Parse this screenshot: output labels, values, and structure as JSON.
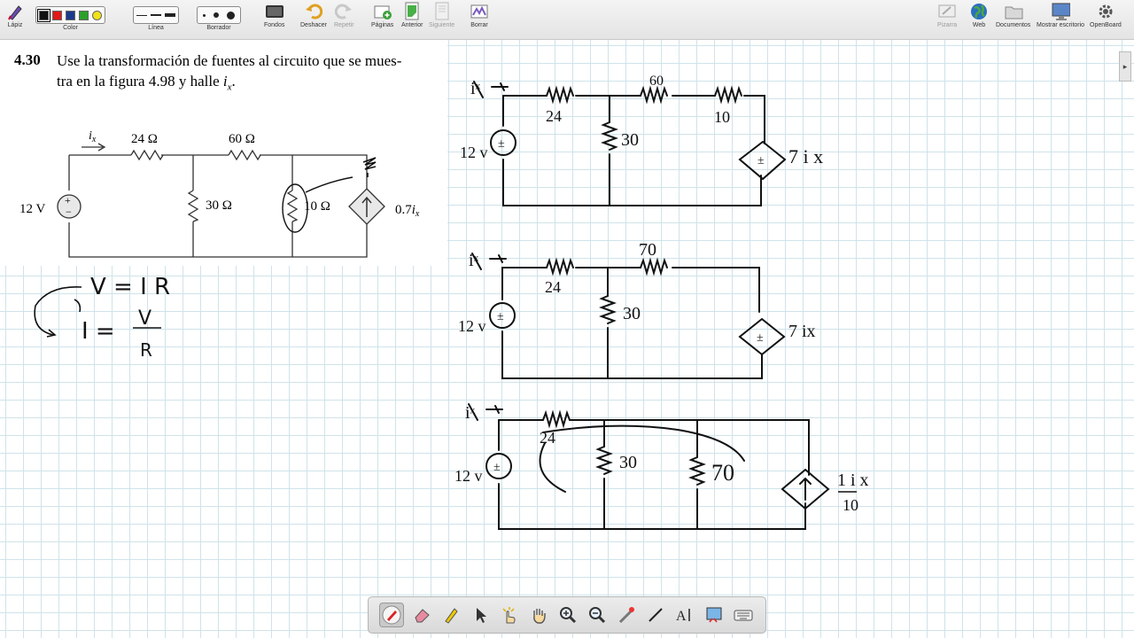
{
  "toolbar": {
    "pen_label": "Lápiz",
    "color_label": "Color",
    "line_label": "Línea",
    "eraser_label": "Borrador",
    "backgrounds_label": "Fondos",
    "undo_label": "Deshacer",
    "redo_label": "Repetir",
    "pages_label": "Páginas",
    "previous_label": "Anterior",
    "next_label": "Siguiente",
    "clear_label": "Borrar",
    "board_label": "Pizarra",
    "web_label": "Web",
    "documents_label": "Documentos",
    "show_desktop_label": "Mostrar escritorio",
    "openboard_label": "OpenBoard",
    "colors": [
      "#111111",
      "#e01818",
      "#1a3a8a",
      "#2aa02a",
      "#f2e21a"
    ]
  },
  "problem": {
    "number": "4.30",
    "text_line1": "Use la transformación de fuentes al circuito que se mues-",
    "text_line2_pre": "tra en la figura 4.98 y halle ",
    "text_var": "i",
    "text_sub": "x",
    "text_end": "."
  },
  "figure": {
    "current_var": "i",
    "current_sub": "x",
    "r1": "24 Ω",
    "r2": "60 Ω",
    "r3": "30 Ω",
    "r4": "10 Ω",
    "source": "12 V",
    "dependent": "0.7",
    "dep_var": "i",
    "dep_sub": "x"
  },
  "handwriting": {
    "ohm_v": "V = I R",
    "ohm_i": "I =",
    "ohm_num": "V",
    "ohm_den": "R",
    "c1": {
      "ix": "iˣ",
      "r24": "24",
      "r60": "60",
      "r10": "10",
      "r30": "30",
      "v": "12 v",
      "dep": "7 i x"
    },
    "c2": {
      "ix": "iˣ",
      "r24": "24",
      "r70": "70",
      "r30": "30",
      "v": "12 v",
      "dep": "7 ix"
    },
    "c3": {
      "ix": "iˣ",
      "r24": "24",
      "r30": "30",
      "r70": "70",
      "v": "12 v",
      "dep_num": "1 i x",
      "dep_den": "10"
    }
  }
}
